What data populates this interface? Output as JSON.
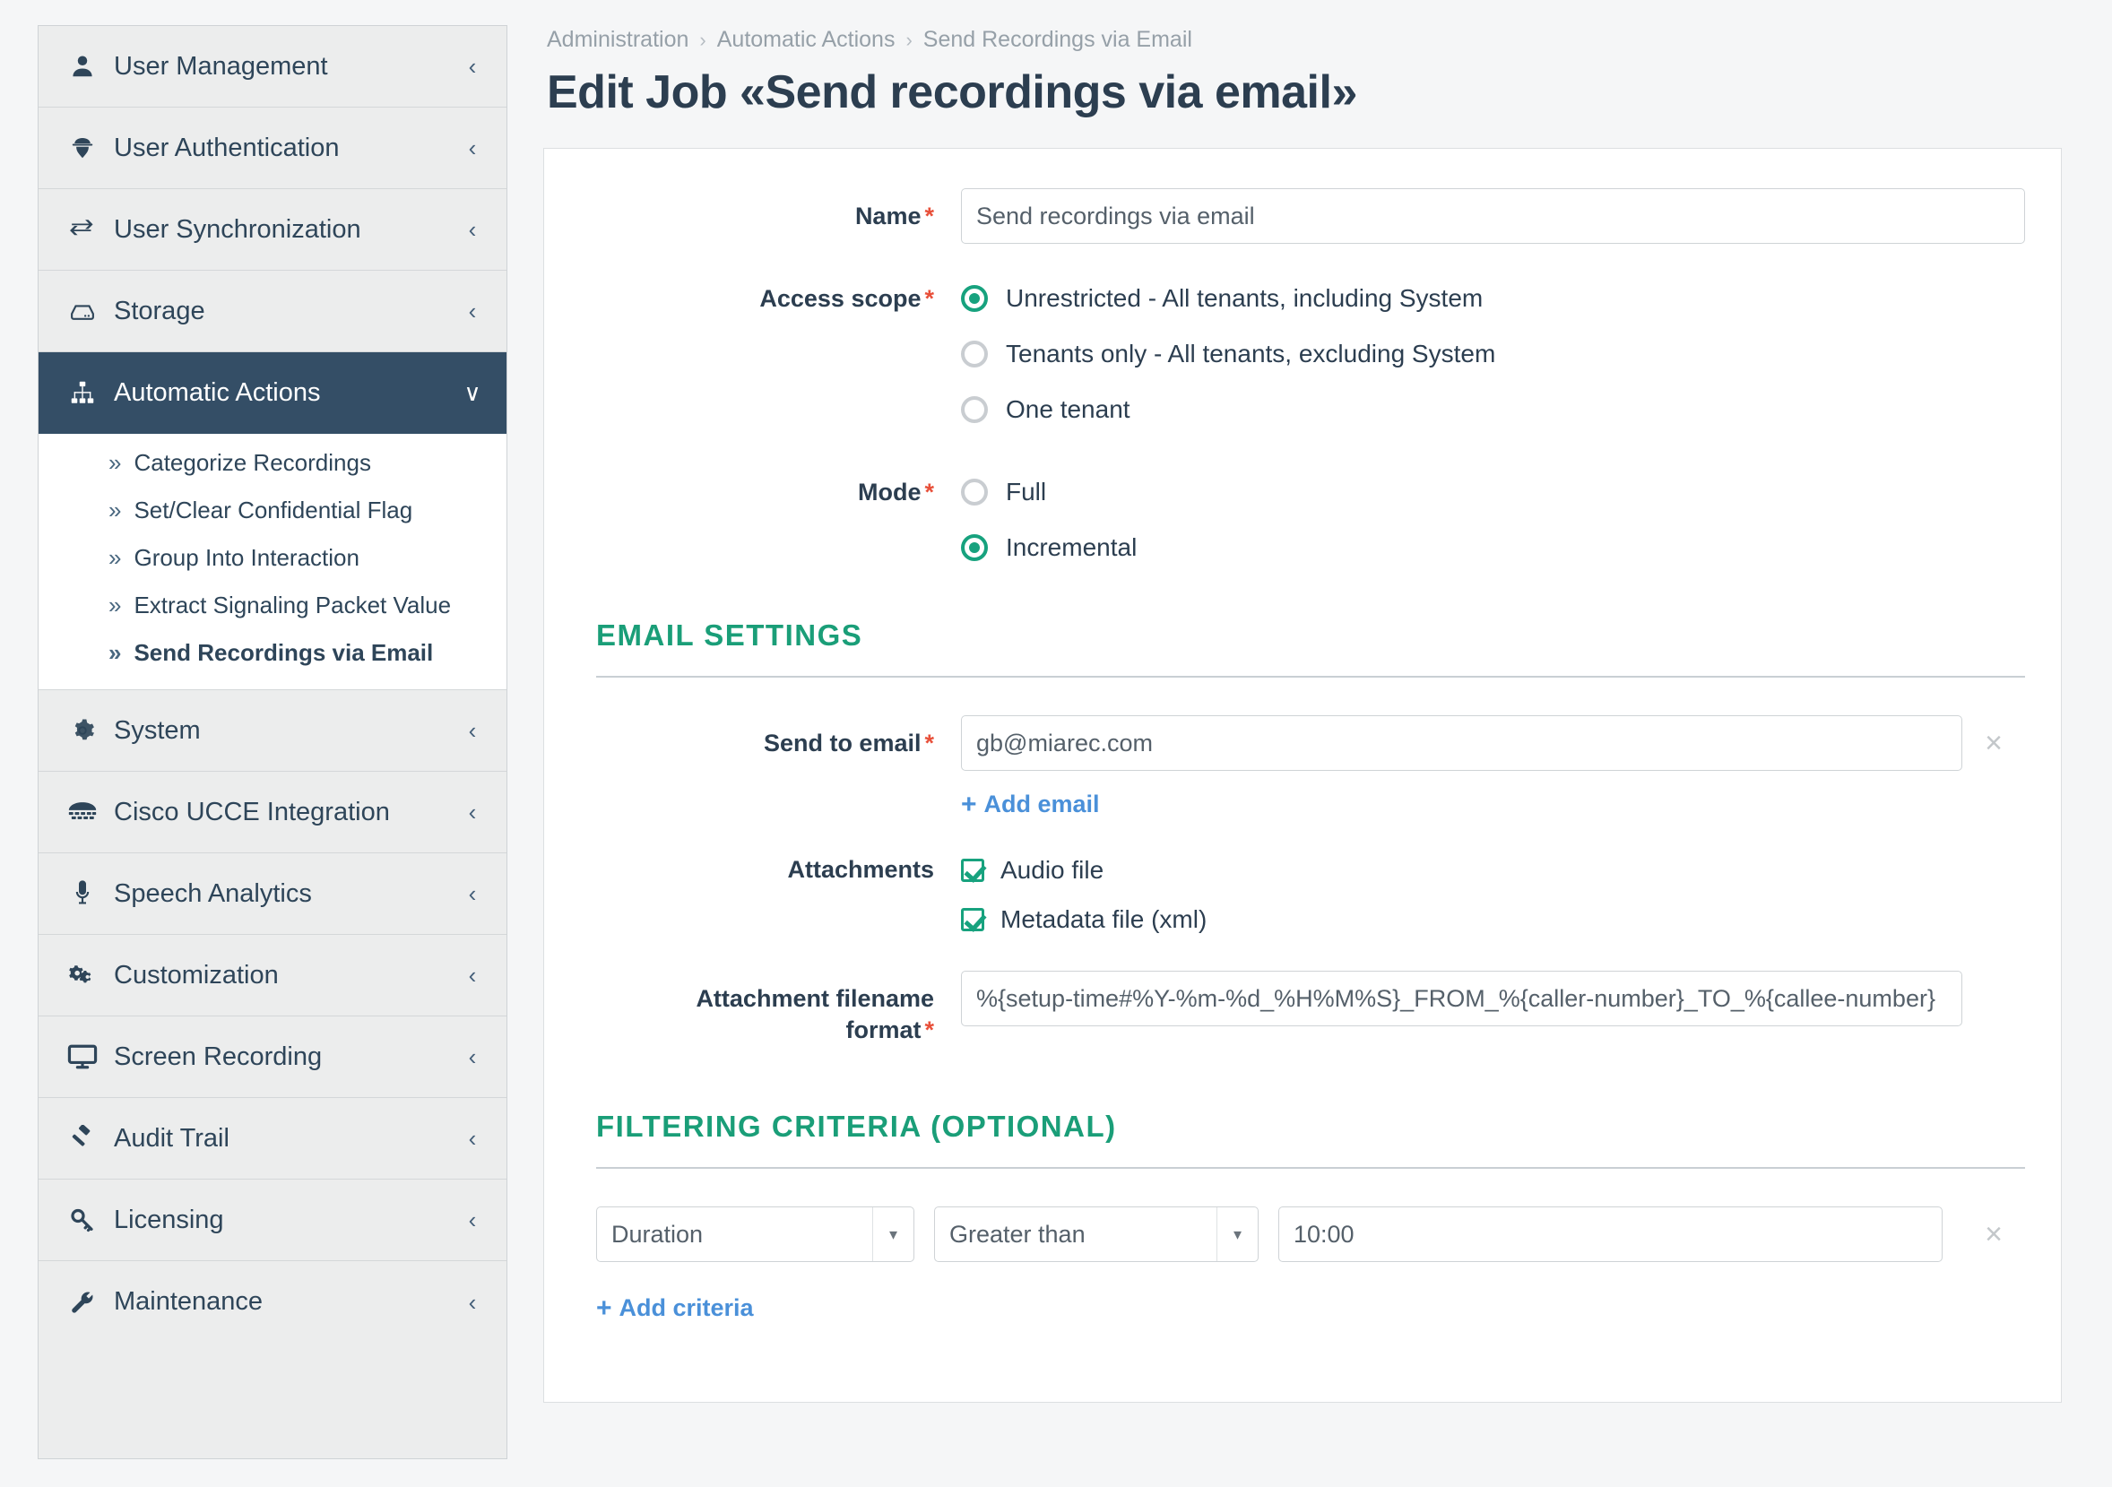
{
  "sidebar": {
    "items": [
      {
        "label": "User Management",
        "icon": "user-icon",
        "chevron": "‹",
        "active": false
      },
      {
        "label": "User Authentication",
        "icon": "user-secret-icon",
        "chevron": "‹",
        "active": false
      },
      {
        "label": "User Synchronization",
        "icon": "exchange-icon",
        "chevron": "‹",
        "active": false
      },
      {
        "label": "Storage",
        "icon": "hdd-icon",
        "chevron": "‹",
        "active": false
      },
      {
        "label": "Automatic Actions",
        "icon": "sitemap-icon",
        "chevron": "∨",
        "active": true
      },
      {
        "label": "System",
        "icon": "gear-icon",
        "chevron": "‹",
        "active": false
      },
      {
        "label": "Cisco UCCE Integration",
        "icon": "phone-icon",
        "chevron": "‹",
        "active": false
      },
      {
        "label": "Speech Analytics",
        "icon": "microphone-icon",
        "chevron": "‹",
        "active": false
      },
      {
        "label": "Customization",
        "icon": "cogs-icon",
        "chevron": "‹",
        "active": false
      },
      {
        "label": "Screen Recording",
        "icon": "desktop-icon",
        "chevron": "‹",
        "active": false
      },
      {
        "label": "Audit Trail",
        "icon": "gavel-icon",
        "chevron": "‹",
        "active": false
      },
      {
        "label": "Licensing",
        "icon": "key-icon",
        "chevron": "‹",
        "active": false
      },
      {
        "label": "Maintenance",
        "icon": "wrench-icon",
        "chevron": "‹",
        "active": false
      }
    ],
    "submenu": {
      "marker": "»",
      "items": [
        {
          "label": "Categorize Recordings",
          "current": false
        },
        {
          "label": "Set/Clear Confidential Flag",
          "current": false
        },
        {
          "label": "Group Into Interaction",
          "current": false
        },
        {
          "label": "Extract Signaling Packet Value",
          "current": false
        },
        {
          "label": "Send Recordings via Email",
          "current": true
        }
      ]
    }
  },
  "breadcrumb": {
    "separator": "›",
    "items": [
      "Administration",
      "Automatic Actions",
      "Send Recordings via Email"
    ]
  },
  "page_title": "Edit Job «Send recordings via email»",
  "form": {
    "required_marker": "*",
    "name": {
      "label": "Name",
      "value": "Send recordings via email",
      "placeholder": "Send recordings via email"
    },
    "access_scope": {
      "label": "Access scope",
      "options": [
        {
          "label": "Unrestricted - All tenants, including System",
          "selected": true
        },
        {
          "label": "Tenants only - All tenants, excluding System",
          "selected": false
        },
        {
          "label": "One tenant",
          "selected": false
        }
      ]
    },
    "mode": {
      "label": "Mode",
      "options": [
        {
          "label": "Full",
          "selected": false
        },
        {
          "label": "Incremental",
          "selected": true
        }
      ]
    }
  },
  "email_settings": {
    "heading": "EMAIL  SETTINGS",
    "send_to_email": {
      "label": "Send to email",
      "value": "gb@miarec.com",
      "placeholder": "gb@miarec.com",
      "remove_icon": "×"
    },
    "add_email": {
      "plus": "+",
      "label": "Add email"
    },
    "attachments": {
      "label": "Attachments",
      "options": [
        {
          "label": "Audio file",
          "checked": true
        },
        {
          "label": "Metadata file (xml)",
          "checked": true
        }
      ]
    },
    "attachment_filename_format": {
      "label_line1": "Attachment filename",
      "label_line2": "format",
      "value": "%{setup-time#%Y-%m-%d_%H%M%S}_FROM_%{caller-number}_TO_%{callee-number}",
      "placeholder": "%{setup-time#%Y-%m-%d_%H%M%S}_FROM_%{caller-number}_TO_%{callee-number}"
    }
  },
  "filtering_criteria": {
    "heading": "FILTERING  CRITERIA  (OPTIONAL)",
    "rows": [
      {
        "field": "Duration",
        "operator": "Greater than",
        "value": "10:00",
        "placeholder": "10:00",
        "arrow": "▾",
        "remove_icon": "×"
      }
    ],
    "add_criteria": {
      "plus": "+",
      "label": "Add criteria"
    }
  },
  "colors": {
    "accent_teal": "#17a27e",
    "heading_teal": "#1a9e78",
    "link_blue": "#4a90d9",
    "active_nav": "#344e66",
    "required_red": "#e8503a",
    "page_bg": "#f5f6f7"
  }
}
